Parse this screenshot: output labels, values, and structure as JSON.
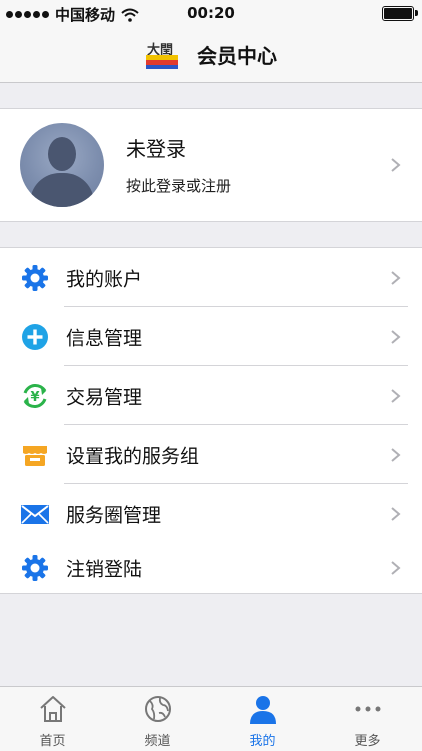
{
  "status_bar": {
    "carrier": "中国移动",
    "time": "00:20"
  },
  "navbar": {
    "title": "会员中心",
    "logo_text": "大閏"
  },
  "profile": {
    "name": "未登录",
    "subtitle": "按此登录或注册"
  },
  "menu": {
    "items": [
      {
        "label": "我的账户",
        "icon": "gear-icon"
      },
      {
        "label": "信息管理",
        "icon": "plus-circle-icon"
      },
      {
        "label": "交易管理",
        "icon": "yen-exchange-icon"
      },
      {
        "label": "设置我的服务组",
        "icon": "storefront-icon"
      },
      {
        "label": "服务圈管理",
        "icon": "envelope-icon"
      },
      {
        "label": "注销登陆",
        "icon": "gear-icon"
      }
    ]
  },
  "tabbar": {
    "tabs": [
      {
        "label": "首页",
        "icon": "home-icon"
      },
      {
        "label": "频道",
        "icon": "globe-icon"
      },
      {
        "label": "我的",
        "icon": "person-icon",
        "active": true
      },
      {
        "label": "更多",
        "icon": "more-icon"
      }
    ]
  },
  "colors": {
    "accent": "#1a74e8",
    "green": "#2bb34a",
    "orange": "#f5a623",
    "cyan": "#1fa3e6"
  }
}
